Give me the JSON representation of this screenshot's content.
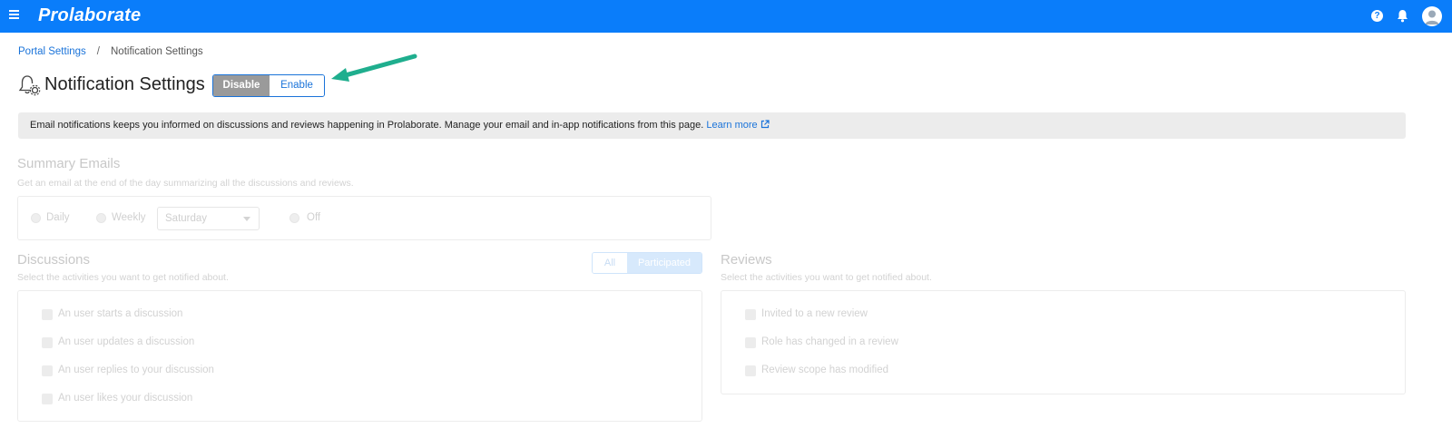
{
  "app": {
    "logo": "Prolaborate",
    "help_icon": "?"
  },
  "breadcrumb": {
    "parent": "Portal Settings",
    "separator": "/",
    "current": "Notification Settings"
  },
  "header": {
    "title": "Notification Settings",
    "toggle": {
      "disable_label": "Disable",
      "enable_label": "Enable"
    }
  },
  "info": {
    "text": "Email notifications keeps you informed on discussions and reviews happening in Prolaborate. Manage your email and in-app notifications from this page.",
    "link": "Learn more"
  },
  "summary": {
    "title": "Summary Emails",
    "description": "Get an email at the end of the day summarizing all the discussions and reviews.",
    "options": [
      "Daily",
      "Weekly",
      "Off"
    ],
    "weekday": "Saturday"
  },
  "discussions": {
    "title": "Discussions",
    "description": "Select the activities you want to get notified about.",
    "filter": [
      "All",
      "Participated"
    ],
    "items": [
      "An user starts a discussion",
      "An user updates a discussion",
      "An user replies to your discussion",
      "An user likes your discussion"
    ]
  },
  "reviews": {
    "title": "Reviews",
    "description": "Select the activities you want to get notified about.",
    "items": [
      "Invited to a new review",
      "Role has changed in a review",
      "Review scope has modified"
    ]
  },
  "colors": {
    "topbar": "#0a7dfa",
    "link": "#1a73d9",
    "annotation_arrow": "#1fae8e"
  }
}
